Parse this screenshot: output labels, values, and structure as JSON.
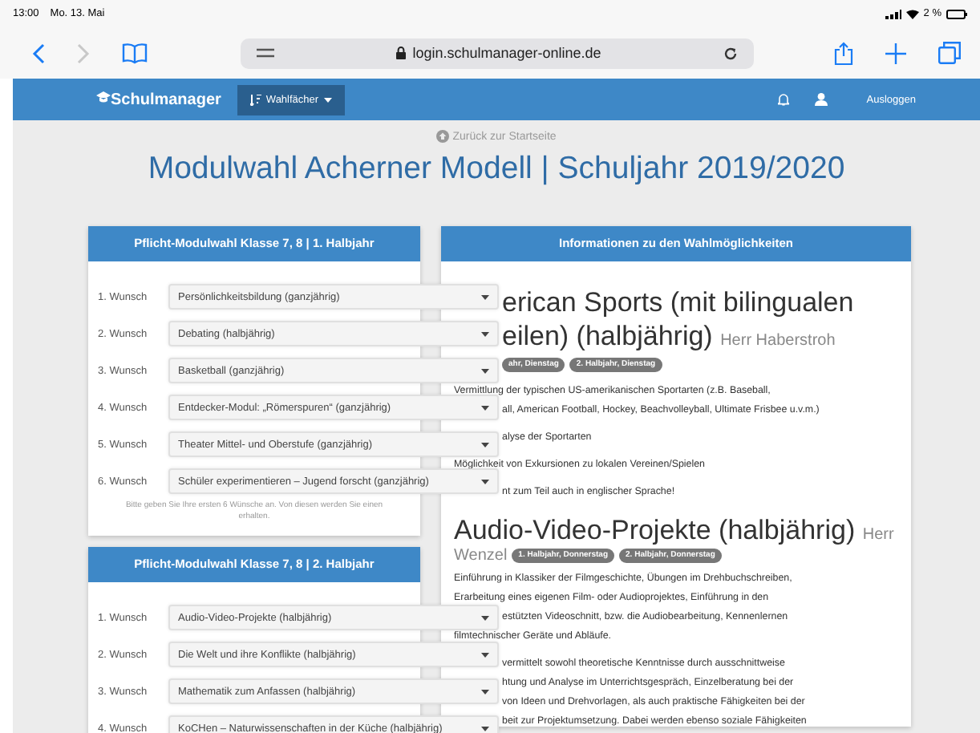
{
  "status_bar": {
    "time": "13:00",
    "date": "Mo. 13. Mai",
    "battery": "2 %"
  },
  "browser": {
    "url": "login.schulmanager-online.de"
  },
  "navbar": {
    "logo": "Schulmanager",
    "menu": "Wahlfächer",
    "logout": "Ausloggen"
  },
  "back_link": "Zurück zur Startseite",
  "title": "Modulwahl Acherner Modell | Schuljahr 2019/2020",
  "panels": [
    {
      "title": "Pflicht-Modulwahl Klasse 7, 8 | 1. Halbjahr",
      "choices": [
        {
          "label": "1. Wunsch",
          "value": "Persönlichkeitsbildung (ganzjährig)"
        },
        {
          "label": "2. Wunsch",
          "value": "Debating (halbjährig)"
        },
        {
          "label": "3. Wunsch",
          "value": "Basketball (ganzjährig)"
        },
        {
          "label": "4. Wunsch",
          "value": "Entdecker-Modul: „Römerspuren“ (ganzjährig)"
        },
        {
          "label": "5. Wunsch",
          "value": "Theater Mittel- und Oberstufe (ganzjährig)"
        },
        {
          "label": "6. Wunsch",
          "value": "Schüler experimentieren – Jugend forscht (ganzjährig)"
        }
      ],
      "hint": "Bitte geben Sie Ihre ersten 6 Wünsche an. Von diesen werden Sie einen erhalten."
    },
    {
      "title": "Pflicht-Modulwahl Klasse 7, 8 | 2. Halbjahr",
      "choices": [
        {
          "label": "1. Wunsch",
          "value": "Audio-Video-Projekte (halbjährig)"
        },
        {
          "label": "2. Wunsch",
          "value": "Die Welt und ihre Konflikte (halbjährig)"
        },
        {
          "label": "3. Wunsch",
          "value": "Mathematik zum Anfassen (halbjährig)"
        },
        {
          "label": "4. Wunsch",
          "value": "KoCHen – Naturwissenschaften in der Küche (halbjährig)"
        }
      ]
    }
  ],
  "info": {
    "title": "Informationen zu den Wahlmöglichkeiten",
    "items": [
      {
        "kind": "heading",
        "text": "erican Sports (mit bilingualen",
        "partly_hidden": true
      },
      {
        "kind": "heading",
        "text": "eilen) (halbjährig)",
        "teacher": "Herr Haberstroh",
        "partly_hidden": true
      },
      {
        "kind": "badges",
        "badges": [
          "ahr, Dienstag",
          "2. Halbjahr, Dienstag"
        ],
        "partly_hidden": true
      },
      {
        "kind": "paragraph",
        "lines": [
          {
            "text": "Vermittlung der typischen US-amerikanischen Sportarten (z.B. Baseball,",
            "partly_hidden": false
          },
          {
            "text": "all, American Football, Hockey, Beachvolleyball, Ultimate Frisbee u.v.m.)",
            "partly_hidden": true
          }
        ]
      },
      {
        "kind": "paragraph",
        "lines": [
          {
            "text": "alyse der Sportarten",
            "partly_hidden": true
          }
        ]
      },
      {
        "kind": "paragraph",
        "lines": [
          {
            "text": "Möglichkeit von Exkursionen zu lokalen Vereinen/Spielen",
            "partly_hidden": false
          }
        ]
      },
      {
        "kind": "paragraph",
        "lines": [
          {
            "text": "nt zum Teil auch in englischer Sprache!",
            "partly_hidden": true
          }
        ]
      },
      {
        "kind": "heading",
        "text": "Audio-Video-Projekte (halbjährig)",
        "teacher": "Herr",
        "partly_hidden": false
      },
      {
        "kind": "teacher_line",
        "teacher": "Wenzel",
        "badges": [
          "1. Halbjahr, Donnerstag",
          "2. Halbjahr, Donnerstag"
        ],
        "partly_hidden": false
      },
      {
        "kind": "paragraph",
        "lines": [
          {
            "text": "Einführung in Klassiker der Filmgeschichte, Übungen im Drehbuchschreiben,",
            "partly_hidden": false
          },
          {
            "text": "Erarbeitung eines eigenen Film- oder Audioprojektes, Einführung in den",
            "partly_hidden": false
          },
          {
            "text": "estützten Videoschnitt, bzw. die Audiobearbeitung, Kennenlernen",
            "partly_hidden": true
          },
          {
            "text": "filmtechnischer Geräte und Abläufe.",
            "partly_hidden": false
          }
        ]
      },
      {
        "kind": "paragraph",
        "lines": [
          {
            "text": "vermittelt sowohl theoretische Kenntnisse durch ausschnittweise",
            "partly_hidden": true
          },
          {
            "text": "htung und Analyse im Unterrichtsgespräch, Einzelberatung bei der",
            "partly_hidden": true
          },
          {
            "text": "von Ideen und Drehvorlagen, als auch praktische Fähigkeiten bei der",
            "partly_hidden": true
          },
          {
            "text": "beit zur Projektumsetzung. Dabei werden ebenso soziale Fähigkeiten",
            "partly_hidden": true
          }
        ]
      }
    ]
  }
}
